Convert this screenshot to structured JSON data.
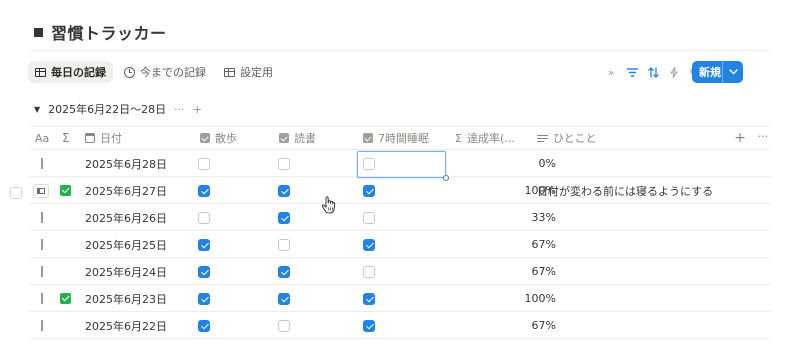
{
  "page": {
    "title": "習慣トラッカー"
  },
  "views": {
    "tabs": [
      {
        "label": "毎日の記録",
        "icon": "table-icon",
        "active": true
      },
      {
        "label": "今までの記録",
        "icon": "clock-icon",
        "active": false
      },
      {
        "label": "設定用",
        "icon": "table-icon",
        "active": false
      }
    ]
  },
  "toolbar": {
    "icons": [
      "double-chevron-right-icon",
      "filter-icon",
      "sort-icon",
      "lightning-icon",
      "search-icon",
      "expand-icon",
      "settings-sliders-icon"
    ],
    "new_label": "新規",
    "new_dropdown_icon": "chevron-down-icon",
    "accent_color": "#2383e2"
  },
  "group": {
    "label": "2025年6月22日〜28日",
    "more": "···",
    "add": "+"
  },
  "columns": {
    "title_icon": "Aa",
    "sum_icon": "Σ",
    "date": "日付",
    "walk": "散歩",
    "read": "読書",
    "sleep": "7時間睡眠",
    "rate": "達成率(...",
    "memo": "ひとこと",
    "add": "+",
    "more": "···"
  },
  "rows": [
    {
      "date": "2025年6月28日",
      "walk": false,
      "read": false,
      "sleep": false,
      "rate": "0%",
      "memo": "",
      "done": false
    },
    {
      "date": "2025年6月27日",
      "walk": true,
      "read": true,
      "sleep": true,
      "rate": "100%",
      "memo": "日付が変わる前には寝るようにする",
      "done": true
    },
    {
      "date": "2025年6月26日",
      "walk": false,
      "read": true,
      "sleep": false,
      "rate": "33%",
      "memo": "",
      "done": false
    },
    {
      "date": "2025年6月25日",
      "walk": true,
      "read": false,
      "sleep": true,
      "rate": "67%",
      "memo": "",
      "done": false
    },
    {
      "date": "2025年6月24日",
      "walk": true,
      "read": true,
      "sleep": false,
      "rate": "67%",
      "memo": "",
      "done": false
    },
    {
      "date": "2025年6月23日",
      "walk": true,
      "read": true,
      "sleep": true,
      "rate": "100%",
      "memo": "",
      "done": true
    },
    {
      "date": "2025年6月22日",
      "walk": true,
      "read": false,
      "sleep": true,
      "rate": "67%",
      "memo": "",
      "done": false
    }
  ],
  "colors": {
    "check_blue": "#2383e2",
    "done_green": "#22b14c",
    "text": "#37352f",
    "muted": "#8a8883"
  }
}
